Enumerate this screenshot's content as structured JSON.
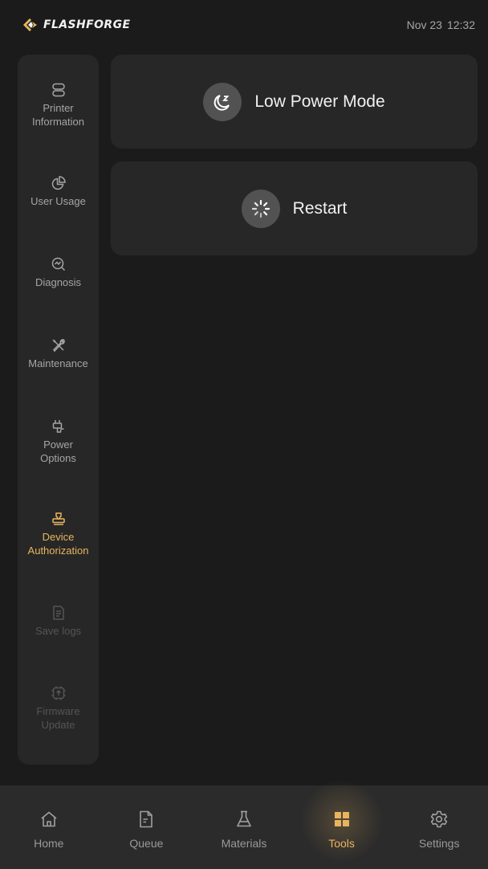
{
  "header": {
    "brand": "FLASHFORGE",
    "date": "Nov 23",
    "time": "12:32"
  },
  "colors": {
    "accent": "#e8b55e",
    "background": "#1b1b1b",
    "panel": "#272727",
    "disabled": "#555555"
  },
  "sidebar": {
    "items": [
      {
        "label": "Printer\nInformation",
        "icon": "printer-info-icon",
        "state": "normal"
      },
      {
        "label": "User Usage",
        "icon": "pie-chart-icon",
        "state": "normal"
      },
      {
        "label": "Diagnosis",
        "icon": "diagnosis-icon",
        "state": "normal"
      },
      {
        "label": "Maintenance",
        "icon": "wrench-screwdriver-icon",
        "state": "normal"
      },
      {
        "label": "Power\nOptions",
        "icon": "power-plug-icon",
        "state": "normal"
      },
      {
        "label": "Device\nAuthorization",
        "icon": "stamp-icon",
        "state": "active"
      },
      {
        "label": "Save logs",
        "icon": "document-icon",
        "state": "disabled"
      },
      {
        "label": "Firmware\nUpdate",
        "icon": "chip-upload-icon",
        "state": "disabled"
      }
    ]
  },
  "main": {
    "actions": [
      {
        "label": "Low Power Mode",
        "icon": "moon-sleep-icon"
      },
      {
        "label": "Restart",
        "icon": "spinner-icon"
      }
    ]
  },
  "bottom_nav": {
    "items": [
      {
        "label": "Home",
        "icon": "home-icon"
      },
      {
        "label": "Queue",
        "icon": "queue-document-icon"
      },
      {
        "label": "Materials",
        "icon": "flask-icon"
      },
      {
        "label": "Tools",
        "icon": "grid-icon",
        "active": true
      },
      {
        "label": "Settings",
        "icon": "gear-icon"
      }
    ]
  }
}
